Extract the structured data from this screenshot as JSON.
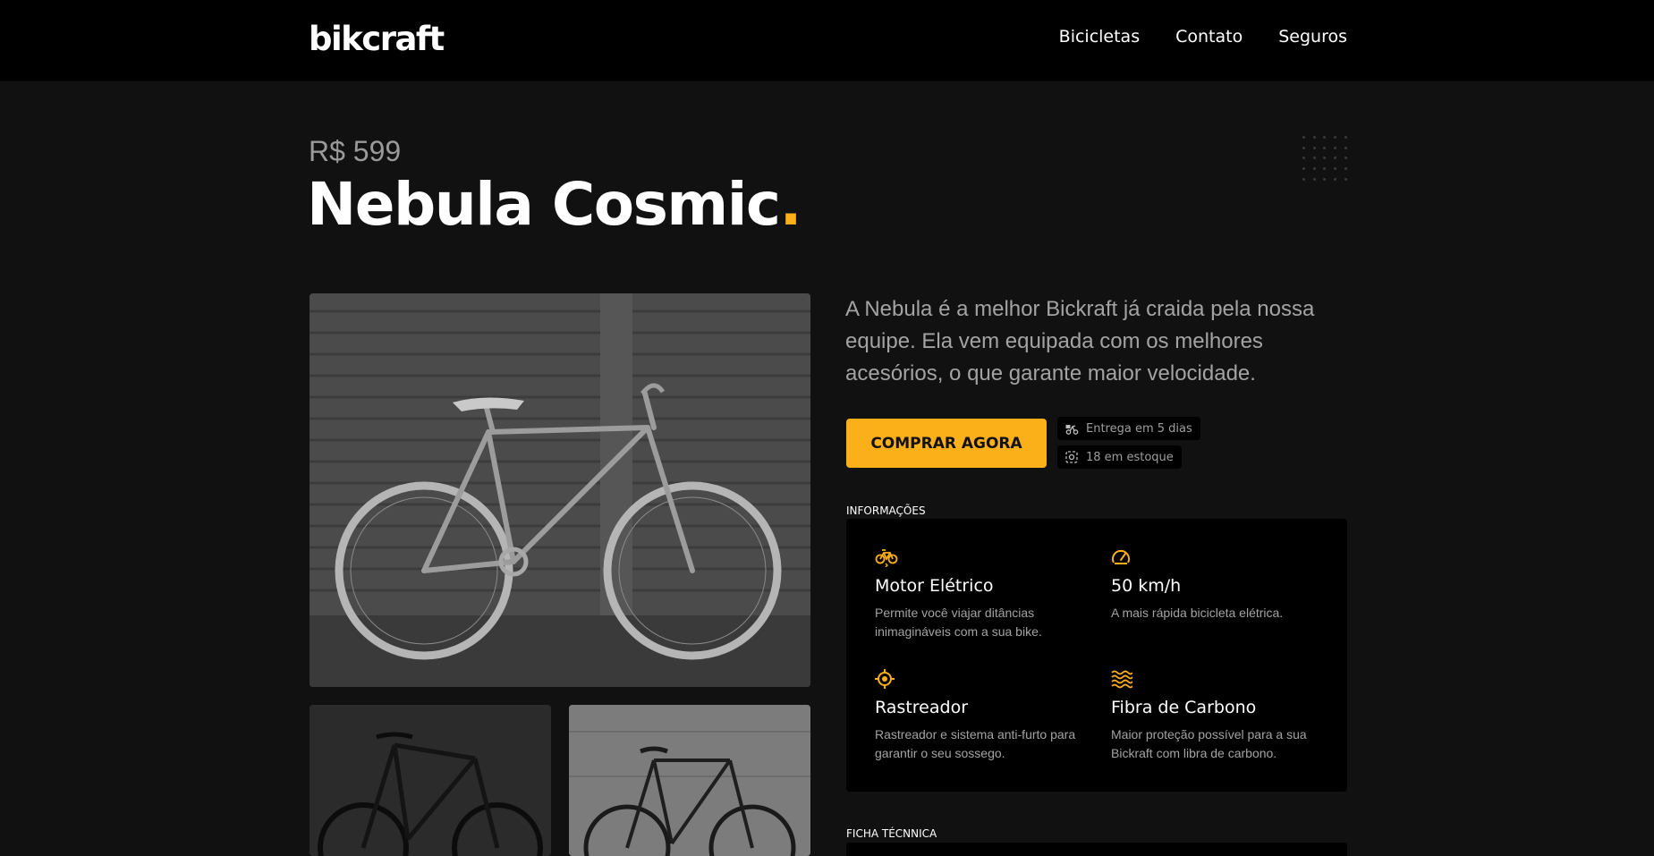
{
  "header": {
    "logo": "bikcraft",
    "nav": [
      "Bicicletas",
      "Contato",
      "Seguros"
    ]
  },
  "product": {
    "price": "R$ 599",
    "name": "Nebula Cosmic",
    "name_dot": ".",
    "description": "A Nebula é a melhor Bickraft já craida pela nossa equipe. Ela vem equipada com os melhores acesórios, o que garante maior velocidade.",
    "buy_label": "COMPRAR AGORA",
    "badges": [
      {
        "icon": "delivery-icon",
        "text": "Entrega em 5 dias"
      },
      {
        "icon": "stock-icon",
        "text": "18 em estoque"
      }
    ]
  },
  "info": {
    "label": "INFORMAÇÕES",
    "features": [
      {
        "icon": "bike-icon",
        "title": "Motor Elétrico",
        "text": "Permite você viajar ditâncias inimagináveis com a sua bike."
      },
      {
        "icon": "speedometer-icon",
        "title": "50 km/h",
        "text": "A mais rápida bicicleta elétrica."
      },
      {
        "icon": "tracker-icon",
        "title": "Rastreador",
        "text": "Rastreador e sistema anti-furto para garantir o seu sossego."
      },
      {
        "icon": "carbon-fiber-icon",
        "title": "Fibra de Carbono",
        "text": "Maior proteção possível para a sua Bickraft com libra de carbono."
      }
    ]
  },
  "ficha": {
    "label": "FICHA TÉCNNICA"
  },
  "colors": {
    "accent": "#fbb01a",
    "background": "#111111",
    "header": "#000000",
    "muted_text": "#a3a3a3"
  }
}
